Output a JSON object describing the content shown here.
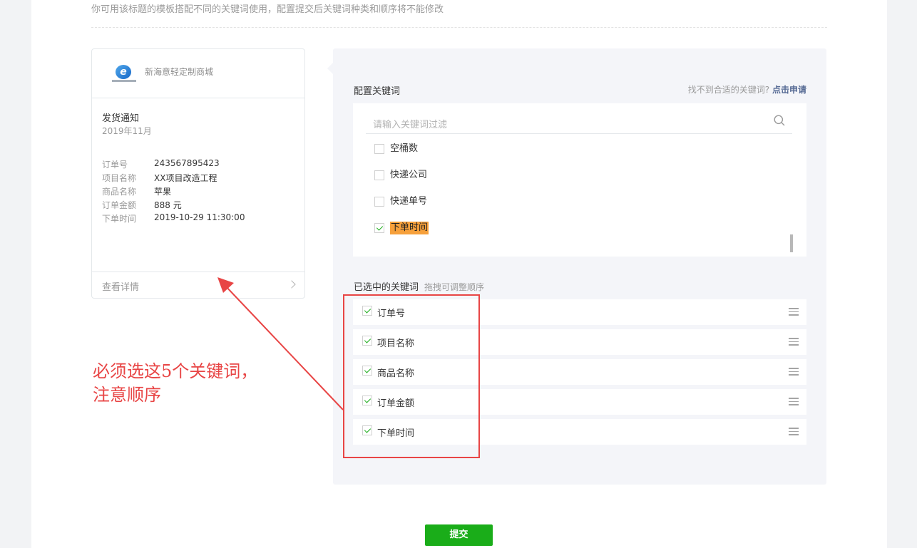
{
  "header": {
    "hint": "你可用该标题的模板搭配不同的关键词使用，配置提交后关键词种类和顺序将不能修改"
  },
  "preview": {
    "shop_name": "新海意轻定制商城",
    "title": "发货通知",
    "date": "2019年11月",
    "fields": [
      {
        "key": "订单号",
        "value": "243567895423"
      },
      {
        "key": "项目名称",
        "value": "XX项目改造工程"
      },
      {
        "key": "商品名称",
        "value": "苹果"
      },
      {
        "key": "订单金额",
        "value": "888 元"
      },
      {
        "key": "下单时间",
        "value": "2019-10-29 11:30:00"
      }
    ],
    "detail_label": "查看详情"
  },
  "config": {
    "label": "配置关键词",
    "help_text": "找不到合适的关键词?",
    "help_link": "点击申请",
    "search_placeholder": "请输入关键词过滤",
    "keywords": [
      {
        "label": "空桶数",
        "checked": false
      },
      {
        "label": "快递公司",
        "checked": false
      },
      {
        "label": "快递单号",
        "checked": false
      },
      {
        "label": "下单时间",
        "checked": true
      }
    ]
  },
  "selected": {
    "label": "已选中的关键词",
    "sub": "拖拽可调整顺序",
    "items": [
      {
        "label": "订单号"
      },
      {
        "label": "项目名称"
      },
      {
        "label": "商品名称"
      },
      {
        "label": "订单金额"
      },
      {
        "label": "下单时间"
      }
    ]
  },
  "annotation": {
    "line1": "必须选这5个关键词，",
    "line2": "注意顺序",
    "color": "#e84545"
  },
  "submit_label": "提交",
  "colors": {
    "accent": "#1aad19",
    "link": "#576b95",
    "highlight": "#f6a03b"
  }
}
